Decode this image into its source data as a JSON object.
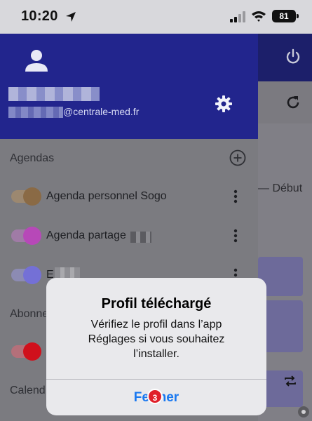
{
  "status_bar": {
    "time": "10:20",
    "battery": "81"
  },
  "drawer": {
    "email_suffix": "@centrale-med.fr",
    "sections": {
      "agendas": "Agendas",
      "abonnements": "Abonne",
      "calendriers": "Calend"
    },
    "agendas": [
      {
        "label": "Agenda personnel Sogo",
        "color": "#8a6a45",
        "track": "#9c8870"
      },
      {
        "label": "Agenda partage",
        "color": "#b748b8",
        "track": "#a07ba6"
      },
      {
        "label": "E",
        "color": "#7470d6",
        "track": "#8c8bb3"
      }
    ],
    "subscription_toggle": {
      "color": "#d0101c",
      "track": "#b4707a"
    }
  },
  "background": {
    "debut_label": "Début"
  },
  "alert": {
    "title": "Profil téléchargé",
    "message": "Vérifiez le profil dans l’app Réglages si vous souhaitez l’installer.",
    "button": "Fermer",
    "badge_count": "3"
  },
  "icons": [
    "location-arrow-icon",
    "signal-icon",
    "wifi-icon",
    "battery-icon",
    "power-icon",
    "refresh-icon",
    "avatar-icon",
    "gear-icon",
    "add-circle-icon",
    "kebab-icon",
    "repeat-icon"
  ]
}
